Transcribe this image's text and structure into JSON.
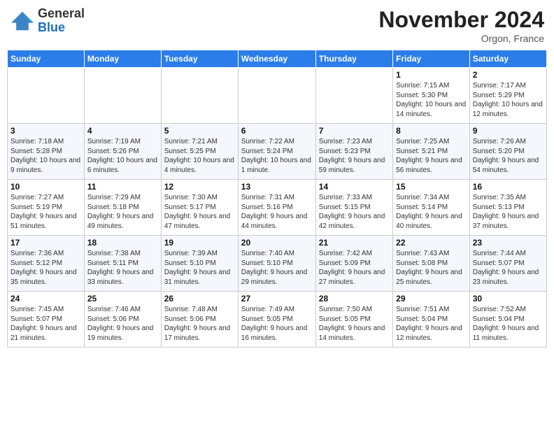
{
  "header": {
    "logo_general": "General",
    "logo_blue": "Blue",
    "month_title": "November 2024",
    "location": "Orgon, France"
  },
  "weekdays": [
    "Sunday",
    "Monday",
    "Tuesday",
    "Wednesday",
    "Thursday",
    "Friday",
    "Saturday"
  ],
  "weeks": [
    [
      {
        "day": "",
        "info": ""
      },
      {
        "day": "",
        "info": ""
      },
      {
        "day": "",
        "info": ""
      },
      {
        "day": "",
        "info": ""
      },
      {
        "day": "",
        "info": ""
      },
      {
        "day": "1",
        "info": "Sunrise: 7:15 AM\nSunset: 5:30 PM\nDaylight: 10 hours and 14 minutes."
      },
      {
        "day": "2",
        "info": "Sunrise: 7:17 AM\nSunset: 5:29 PM\nDaylight: 10 hours and 12 minutes."
      }
    ],
    [
      {
        "day": "3",
        "info": "Sunrise: 7:18 AM\nSunset: 5:28 PM\nDaylight: 10 hours and 9 minutes."
      },
      {
        "day": "4",
        "info": "Sunrise: 7:19 AM\nSunset: 5:26 PM\nDaylight: 10 hours and 6 minutes."
      },
      {
        "day": "5",
        "info": "Sunrise: 7:21 AM\nSunset: 5:25 PM\nDaylight: 10 hours and 4 minutes."
      },
      {
        "day": "6",
        "info": "Sunrise: 7:22 AM\nSunset: 5:24 PM\nDaylight: 10 hours and 1 minute."
      },
      {
        "day": "7",
        "info": "Sunrise: 7:23 AM\nSunset: 5:23 PM\nDaylight: 9 hours and 59 minutes."
      },
      {
        "day": "8",
        "info": "Sunrise: 7:25 AM\nSunset: 5:21 PM\nDaylight: 9 hours and 56 minutes."
      },
      {
        "day": "9",
        "info": "Sunrise: 7:26 AM\nSunset: 5:20 PM\nDaylight: 9 hours and 54 minutes."
      }
    ],
    [
      {
        "day": "10",
        "info": "Sunrise: 7:27 AM\nSunset: 5:19 PM\nDaylight: 9 hours and 51 minutes."
      },
      {
        "day": "11",
        "info": "Sunrise: 7:29 AM\nSunset: 5:18 PM\nDaylight: 9 hours and 49 minutes."
      },
      {
        "day": "12",
        "info": "Sunrise: 7:30 AM\nSunset: 5:17 PM\nDaylight: 9 hours and 47 minutes."
      },
      {
        "day": "13",
        "info": "Sunrise: 7:31 AM\nSunset: 5:16 PM\nDaylight: 9 hours and 44 minutes."
      },
      {
        "day": "14",
        "info": "Sunrise: 7:33 AM\nSunset: 5:15 PM\nDaylight: 9 hours and 42 minutes."
      },
      {
        "day": "15",
        "info": "Sunrise: 7:34 AM\nSunset: 5:14 PM\nDaylight: 9 hours and 40 minutes."
      },
      {
        "day": "16",
        "info": "Sunrise: 7:35 AM\nSunset: 5:13 PM\nDaylight: 9 hours and 37 minutes."
      }
    ],
    [
      {
        "day": "17",
        "info": "Sunrise: 7:36 AM\nSunset: 5:12 PM\nDaylight: 9 hours and 35 minutes."
      },
      {
        "day": "18",
        "info": "Sunrise: 7:38 AM\nSunset: 5:11 PM\nDaylight: 9 hours and 33 minutes."
      },
      {
        "day": "19",
        "info": "Sunrise: 7:39 AM\nSunset: 5:10 PM\nDaylight: 9 hours and 31 minutes."
      },
      {
        "day": "20",
        "info": "Sunrise: 7:40 AM\nSunset: 5:10 PM\nDaylight: 9 hours and 29 minutes."
      },
      {
        "day": "21",
        "info": "Sunrise: 7:42 AM\nSunset: 5:09 PM\nDaylight: 9 hours and 27 minutes."
      },
      {
        "day": "22",
        "info": "Sunrise: 7:43 AM\nSunset: 5:08 PM\nDaylight: 9 hours and 25 minutes."
      },
      {
        "day": "23",
        "info": "Sunrise: 7:44 AM\nSunset: 5:07 PM\nDaylight: 9 hours and 23 minutes."
      }
    ],
    [
      {
        "day": "24",
        "info": "Sunrise: 7:45 AM\nSunset: 5:07 PM\nDaylight: 9 hours and 21 minutes."
      },
      {
        "day": "25",
        "info": "Sunrise: 7:46 AM\nSunset: 5:06 PM\nDaylight: 9 hours and 19 minutes."
      },
      {
        "day": "26",
        "info": "Sunrise: 7:48 AM\nSunset: 5:06 PM\nDaylight: 9 hours and 17 minutes."
      },
      {
        "day": "27",
        "info": "Sunrise: 7:49 AM\nSunset: 5:05 PM\nDaylight: 9 hours and 16 minutes."
      },
      {
        "day": "28",
        "info": "Sunrise: 7:50 AM\nSunset: 5:05 PM\nDaylight: 9 hours and 14 minutes."
      },
      {
        "day": "29",
        "info": "Sunrise: 7:51 AM\nSunset: 5:04 PM\nDaylight: 9 hours and 12 minutes."
      },
      {
        "day": "30",
        "info": "Sunrise: 7:52 AM\nSunset: 5:04 PM\nDaylight: 9 hours and 11 minutes."
      }
    ]
  ]
}
